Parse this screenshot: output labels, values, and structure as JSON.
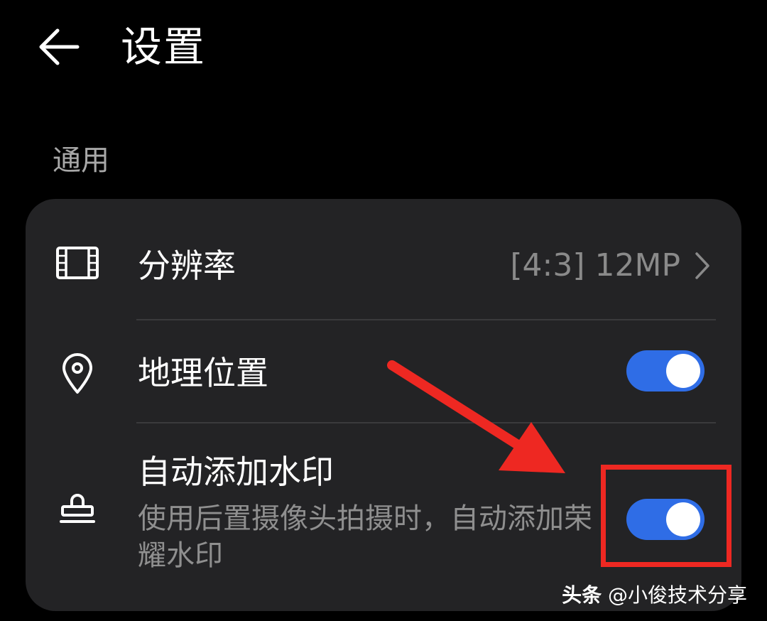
{
  "header": {
    "back_icon": "arrow-left-icon",
    "title": "设置"
  },
  "section": {
    "title": "通用"
  },
  "settings": {
    "resolution": {
      "icon": "film-frame-icon",
      "title": "分辨率",
      "value": "[4:3] 12MP",
      "chevron_icon": "chevron-right-icon"
    },
    "location": {
      "icon": "location-pin-icon",
      "title": "地理位置",
      "enabled": true
    },
    "watermark": {
      "icon": "stamp-icon",
      "title": "自动添加水印",
      "description": "使用后置摄像头拍摄时，自动添加荣耀水印",
      "enabled": true
    }
  },
  "annotation": {
    "arrow_color": "#ee2822",
    "box_color": "#ee2822"
  },
  "colors": {
    "toggle_on": "#2f6de6",
    "card_bg": "#232325",
    "background": "#000000"
  },
  "watermark_overlay": {
    "brand": "头条",
    "author": "@小俊技术分享"
  }
}
